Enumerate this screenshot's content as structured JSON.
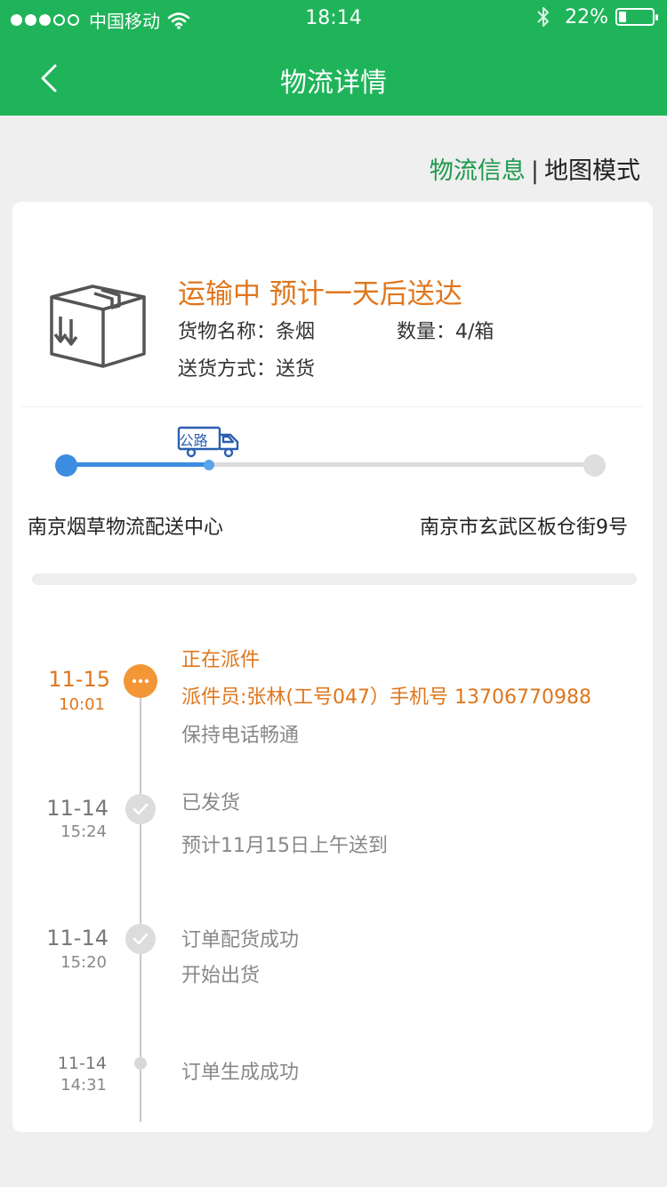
{
  "status_bar": {
    "carrier": "中国移动",
    "time": "18:14",
    "battery": "22%",
    "battery_level": 0.22,
    "signal_bars_filled": 3,
    "signal_bars_total": 5
  },
  "nav": {
    "title": "物流详情",
    "back_icon": "chevron-left-icon"
  },
  "view_mode": {
    "active": "物流信息",
    "separator": "|",
    "inactive": "地图模式"
  },
  "shipment": {
    "status": "运输中 预计一天后送达",
    "goods_label": "货物名称：条烟",
    "quantity_label": "数量：4/箱",
    "delivery_label": "送货方式：送货",
    "icon": "package-box-icon"
  },
  "route": {
    "transport_mode": "公路",
    "from": "南京烟草物流配送中心",
    "to": "南京市玄武区板仓街9号",
    "progress": 0.27
  },
  "timeline": [
    {
      "date": "11-15",
      "time": "10:01",
      "state": "active",
      "icon": "more-dots-icon",
      "lines": [
        "正在派件",
        "派件员:张林(工号047）手机号 13706770988",
        "保持电话畅通"
      ]
    },
    {
      "date": "11-14",
      "time": "15:24",
      "state": "done",
      "icon": "check-icon",
      "lines": [
        "已发货",
        "预计11月15日上午送到"
      ]
    },
    {
      "date": "11-14",
      "time": "15:20",
      "state": "done",
      "icon": "check-icon",
      "lines": [
        "订单配货成功",
        "开始出货"
      ]
    },
    {
      "date": "11-14",
      "time": "14:31",
      "state": "small",
      "icon": "dot-icon",
      "lines": [
        "订单生成成功"
      ]
    }
  ],
  "colors": {
    "brand_green": "#1fb45a",
    "accent_orange": "#e0761c",
    "route_blue": "#3c8ce0"
  }
}
